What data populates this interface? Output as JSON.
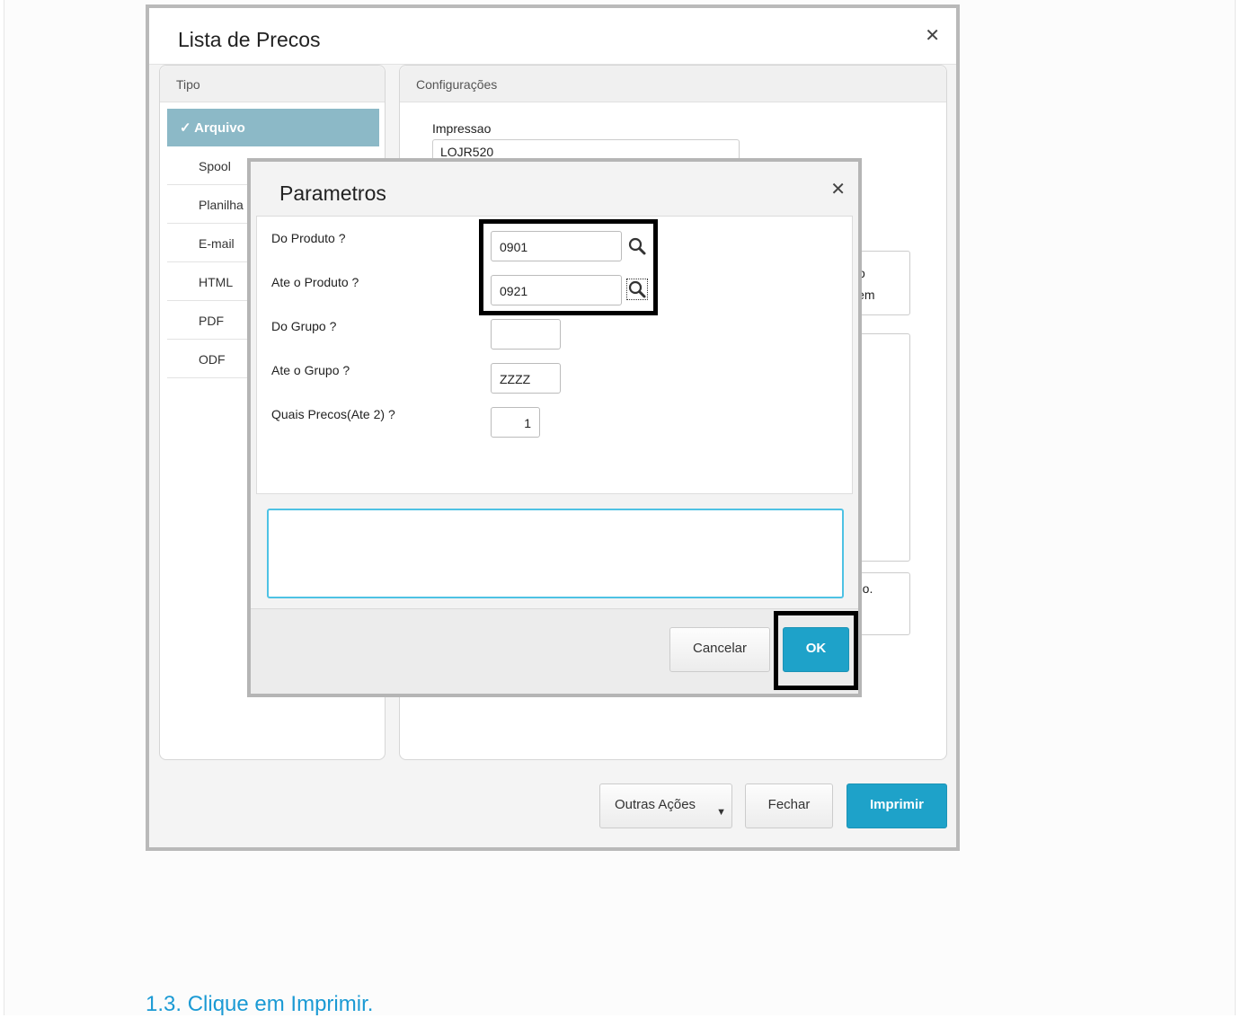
{
  "outer_dialog": {
    "title": "Lista de Precos",
    "tipo_header": "Tipo",
    "config_header": "Configurações",
    "tipo_items": [
      {
        "label": "✓ Arquivo",
        "active": true
      },
      {
        "label": "Spool"
      },
      {
        "label": "Planilha"
      },
      {
        "label": "E-mail"
      },
      {
        "label": "HTML"
      },
      {
        "label": "PDF"
      },
      {
        "label": "ODF"
      }
    ],
    "impressao_label": "Impressao",
    "impressao_value": "LOJR520",
    "partial_text_1": "o",
    "partial_text_2": "jem",
    "partial_text_3": "iario.",
    "footer": {
      "outras_acoes": "Outras Ações",
      "fechar": "Fechar",
      "imprimir": "Imprimir"
    }
  },
  "inner_dialog": {
    "title": "Parametros",
    "params": [
      {
        "label": "Do Produto ?",
        "value": "0901"
      },
      {
        "label": "Ate o Produto ?",
        "value": "0921"
      },
      {
        "label": "Do Grupo ?",
        "value": ""
      },
      {
        "label": "Ate o Grupo ?",
        "value": "ZZZZ"
      },
      {
        "label": "Quais Precos(Ate 2) ?",
        "value": "1"
      }
    ],
    "cancelar": "Cancelar",
    "ok": "OK"
  },
  "caption": "1.3. Clique em Imprimir.",
  "colors": {
    "primary": "#1ea2c9",
    "active_tab": "#8cb9c7",
    "caption": "#1b9ad4"
  }
}
